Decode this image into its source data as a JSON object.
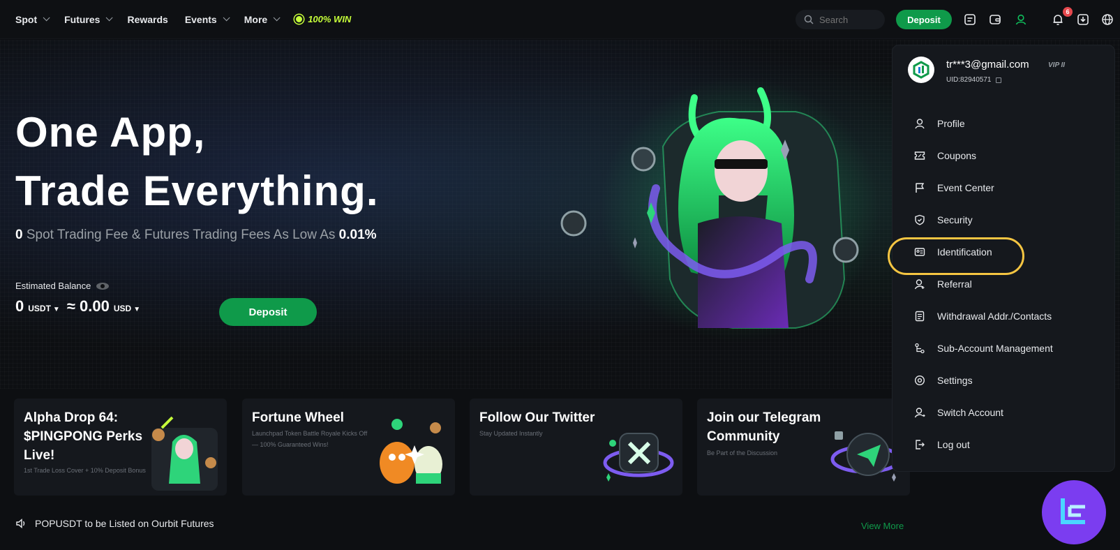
{
  "nav": {
    "items": [
      {
        "label": "Spot",
        "has_dropdown": true
      },
      {
        "label": "Futures",
        "has_dropdown": true
      },
      {
        "label": "Rewards",
        "has_dropdown": false
      },
      {
        "label": "Events",
        "has_dropdown": true
      },
      {
        "label": "More",
        "has_dropdown": true
      }
    ],
    "promo": "100% WIN"
  },
  "header": {
    "search_placeholder": "Search",
    "deposit_label": "Deposit",
    "notification_count": "6",
    "icons": [
      "orders-icon",
      "wallet-icon",
      "user-icon",
      "bell-icon",
      "download-icon",
      "globe-icon"
    ]
  },
  "hero": {
    "title_line1": "One App,",
    "title_line2": "Trade Everything.",
    "sub_fee": "0",
    "sub_text": " Spot Trading Fee & Futures Trading Fees As Low As ",
    "sub_rate": "0.01%",
    "balance_label": "Estimated Balance",
    "balance_value": "0",
    "balance_unit": "USDT",
    "balance_approx": "≈ 0.00",
    "balance_approx_unit": "USD",
    "deposit_label": "Deposit"
  },
  "cards": [
    {
      "title": "Alpha Drop 64: $PINGPONG Perks Live!",
      "desc": "1st Trade Loss Cover + 10% Deposit Bonus"
    },
    {
      "title": "Fortune Wheel",
      "desc": "Launchpad Token Battle Royale Kicks Off — 100% Guaranteed Wins!"
    },
    {
      "title": "Follow Our Twitter",
      "desc": "Stay Updated Instantly"
    },
    {
      "title": "Join our Telegram Community",
      "desc": "Be Part of the Discussion"
    }
  ],
  "ticker": {
    "text": "POPUSDT to be Listed on Ourbit Futures",
    "view_more": "View More"
  },
  "account_menu": {
    "email": "tr***3@gmail.com",
    "vip": "VIP II",
    "uid": "UID:82940571",
    "items": [
      {
        "label": "Profile",
        "icon": "user-icon"
      },
      {
        "label": "Coupons",
        "icon": "coupon-icon"
      },
      {
        "label": "Event Center",
        "icon": "flag-icon"
      },
      {
        "label": "Security",
        "icon": "shield-icon"
      },
      {
        "label": "Identification",
        "icon": "id-card-icon"
      },
      {
        "label": "Referral",
        "icon": "referral-icon"
      },
      {
        "label": "Withdrawal Addr./Contacts",
        "icon": "document-icon"
      },
      {
        "label": "Sub-Account Management",
        "icon": "sub-account-icon"
      },
      {
        "label": "Settings",
        "icon": "settings-icon"
      },
      {
        "label": "Switch Account",
        "icon": "switch-account-icon"
      },
      {
        "label": "Log out",
        "icon": "logout-icon"
      }
    ],
    "highlighted_item": "Identification"
  },
  "colors": {
    "accent_green": "#0f9a4a",
    "highlight_ring": "#f5c542",
    "promo_lime": "#c6ff3a",
    "badge_red": "#e5484d"
  }
}
